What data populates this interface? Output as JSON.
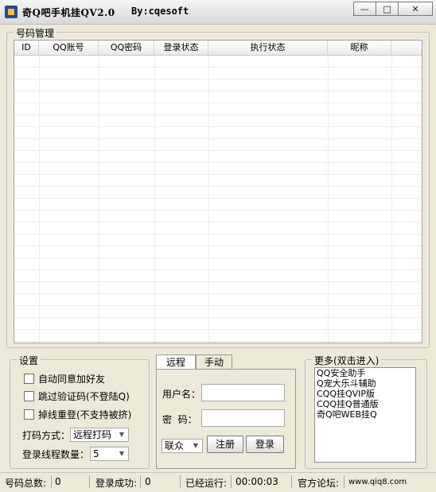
{
  "window": {
    "title": "奇Q吧手机挂QV2.0",
    "author": "By:cqesoft",
    "controls": {
      "minimize": "—",
      "maximize": "□",
      "close": "✕"
    }
  },
  "accounts": {
    "title": "号码管理",
    "columns": [
      "ID",
      "QQ账号",
      "QQ密码",
      "登录状态",
      "执行状态",
      "昵称"
    ]
  },
  "settings": {
    "title": "设置",
    "auto_accept_friend": "自动同意加好友",
    "skip_captcha": "跳过验证码(不登陆Q)",
    "reconnect": "掉线重登(不支持被挤)",
    "captcha_mode_label": "打码方式：",
    "captcha_mode_value": "远程打码",
    "thread_count_label": "登录线程数量：",
    "thread_count_value": "5"
  },
  "login": {
    "tabs": [
      "远程",
      "手动"
    ],
    "username_label": "用户名：",
    "password_label": "密  码：",
    "username_value": "",
    "password_value": "",
    "provider_value": "联众",
    "register_button": "注册",
    "login_button": "登录"
  },
  "more": {
    "title": "更多(双击进入)",
    "items": [
      "QQ安全助手",
      "Q宠大乐斗辅助",
      "CQQ挂QVIP版",
      "CQQ挂Q普通版",
      "奇Q吧WEB挂Q"
    ]
  },
  "status": {
    "total_label": "号码总数:",
    "total_value": "0",
    "success_label": "登录成功:",
    "success_value": "0",
    "running_label": "已经运行:",
    "running_value": "00:00:03",
    "forum_label": "官方论坛:",
    "forum_value": "www.qiq8.com"
  },
  "colors": {
    "window_bg": "#ece9d8",
    "grid_bg": "#ffffff"
  }
}
